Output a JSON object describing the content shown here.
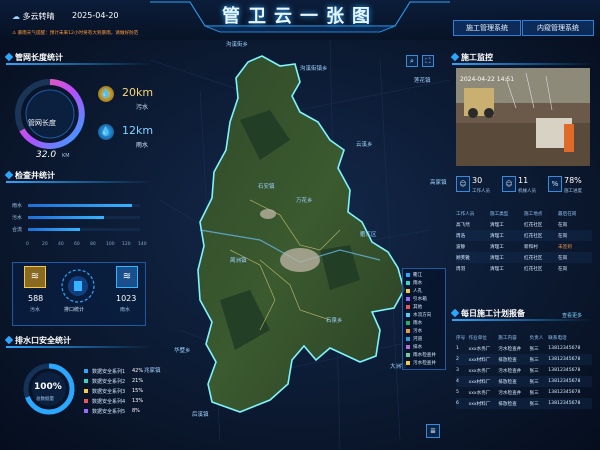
{
  "header": {
    "weather": "多云转晴",
    "date": "2025-04-20",
    "title": "管卫云一张图",
    "alert": "⚠ 暴雨天气提醒：预计未来12小时将有大到暴雨，请做好防范",
    "systems": [
      "施工管理系统",
      "内窥管理系统"
    ]
  },
  "pipe_length": {
    "title": "管网长度统计",
    "gauge_label": "管网长度",
    "gauge_value": "32.0",
    "gauge_unit": "KM",
    "sewage": {
      "value": "20km",
      "label": "污水",
      "icon": "droplet-icon"
    },
    "rain": {
      "value": "12km",
      "label": "雨水",
      "icon": "droplet-icon"
    }
  },
  "inspection_wells": {
    "title": "检查井统计",
    "rows": [
      {
        "label": "雨水",
        "value": 130
      },
      {
        "label": "污水",
        "value": 95
      },
      {
        "label": "合流",
        "value": 65
      }
    ],
    "ticks": [
      "0",
      "20",
      "40",
      "60",
      "80",
      "100",
      "120",
      "140"
    ],
    "cards": {
      "sewage": {
        "value": "588",
        "label": "污水"
      },
      "center": {
        "label": "排口统计"
      },
      "rain": {
        "value": "1023",
        "label": "雨水"
      }
    }
  },
  "outfall_safety": {
    "title": "排水口安全统计",
    "ring_value": "100%",
    "ring_label": "总数据量",
    "items": [
      {
        "name": "数据安全系列1",
        "pct": "42%",
        "color": "#2aa7ff"
      },
      {
        "name": "数据安全系列2",
        "pct": "21%",
        "color": "#35d6c5"
      },
      {
        "name": "数据安全系列3",
        "pct": "15%",
        "color": "#f2c94c"
      },
      {
        "name": "数据安全系列4",
        "pct": "13%",
        "color": "#eb5757"
      },
      {
        "name": "数据安全系列5",
        "pct": "8%",
        "color": "#9b6bff"
      }
    ]
  },
  "construction": {
    "title": "施工监控",
    "timestamp": "2024-04-22 14:51",
    "stats": [
      {
        "value": "30",
        "label": "工作人员",
        "icon": "person-icon"
      },
      {
        "value": "11",
        "label": "机械人员",
        "icon": "person-icon"
      },
      {
        "value": "78%",
        "label": "施工进度",
        "icon": "percent-icon"
      }
    ],
    "table_headers": [
      "工作人员",
      "施工类型",
      "施工地点",
      "最后在岗"
    ],
    "table_rows": [
      [
        "高飞然",
        "清理工",
        "红花社区",
        "在岗"
      ],
      [
        "周浩",
        "清理工",
        "红花社区",
        "在岗"
      ],
      [
        "波静",
        "清理工",
        "新和村",
        "未签到"
      ],
      [
        "顾芙雅",
        "清理工",
        "红花社区",
        "在岗"
      ],
      [
        "周羽",
        "清理工",
        "红花社区",
        "在岗"
      ]
    ]
  },
  "daily_plan": {
    "title": "每日施工计划报备",
    "more": "查看更多",
    "headers": [
      "序号",
      "作业单位",
      "施工内容",
      "负责人",
      "联系电话"
    ],
    "rows": [
      [
        "1",
        "xxx水务厂",
        "污水检查井",
        "张三",
        "13812345678"
      ],
      [
        "2",
        "xxx材料厂",
        "排放检查",
        "张三",
        "13812345678"
      ],
      [
        "3",
        "xxx水务厂",
        "污水检查井",
        "张三",
        "13812345678"
      ],
      [
        "4",
        "xxx材料厂",
        "排放检查",
        "张三",
        "13812345678"
      ],
      [
        "5",
        "xxx水务厂",
        "污水检查井",
        "张三",
        "13812345678"
      ],
      [
        "6",
        "xxx材料厂",
        "排放检查",
        "张三",
        "13812345678"
      ]
    ]
  },
  "map": {
    "place_labels": [
      {
        "text": "沟溪街乡"
      },
      {
        "text": "石安镇"
      },
      {
        "text": "万花乡"
      },
      {
        "text": "蔺洲镇"
      },
      {
        "text": "石泉乡"
      },
      {
        "text": "云溪乡"
      },
      {
        "text": "高家镇"
      },
      {
        "text": "衢江区"
      },
      {
        "text": "兆家镇"
      },
      {
        "text": "华墅乡"
      },
      {
        "text": "后溪镇"
      },
      {
        "text": "大洲镇"
      },
      {
        "text": "莲花镇"
      },
      {
        "text": "沟溪街镇乡"
      }
    ],
    "legend": [
      {
        "text": "衢江",
        "color": "#2aa7ff"
      },
      {
        "text": "雨水",
        "color": "#35d6c5"
      },
      {
        "text": "人孔",
        "color": "#f2c94c"
      },
      {
        "text": "引水箱",
        "color": "#9b6bff"
      },
      {
        "text": "其他",
        "color": "#eb5757"
      },
      {
        "text": "水流方向",
        "color": "#56ccf2"
      },
      {
        "text": "雨水",
        "color": "#27ae60"
      },
      {
        "text": "污水",
        "color": "#f2994a"
      },
      {
        "text": "河道",
        "color": "#2d9cdb"
      },
      {
        "text": "排水",
        "color": "#bb6bd9"
      },
      {
        "text": "雨水检查井",
        "color": "#6fcf97"
      },
      {
        "text": "污水检查井",
        "color": "#f2c94c"
      }
    ]
  }
}
